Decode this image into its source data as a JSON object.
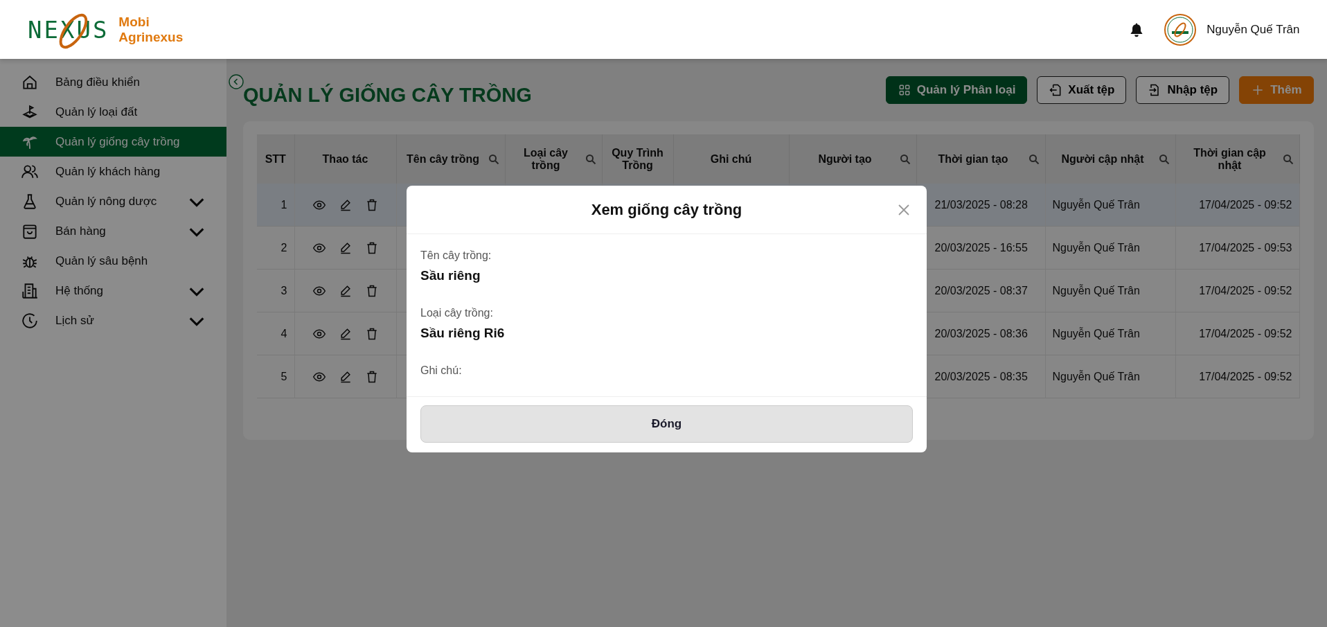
{
  "logo": {
    "mark": "NEXUS",
    "line1": "Mobi",
    "line2": "Agrinexus"
  },
  "user": {
    "name": "Nguyễn Quế Trân"
  },
  "sidebar": {
    "items": [
      {
        "label": "Bảng điều khiển",
        "selected": false,
        "has_submenu": false
      },
      {
        "label": "Quản lý loại đất",
        "selected": false,
        "has_submenu": false
      },
      {
        "label": "Quản lý giống cây trồng",
        "selected": true,
        "has_submenu": false
      },
      {
        "label": "Quản lý khách hàng",
        "selected": false,
        "has_submenu": false
      },
      {
        "label": "Quản lý nông dược",
        "selected": false,
        "has_submenu": true
      },
      {
        "label": "Bán hàng",
        "selected": false,
        "has_submenu": true
      },
      {
        "label": "Quản lý sâu bệnh",
        "selected": false,
        "has_submenu": false
      },
      {
        "label": "Hệ thống",
        "selected": false,
        "has_submenu": true
      },
      {
        "label": "Lịch sử",
        "selected": false,
        "has_submenu": true
      }
    ]
  },
  "page": {
    "title": "QUẢN LÝ GIỐNG CÂY TRỒNG"
  },
  "toolbar": [
    {
      "label": "Quản lý Phân loại",
      "kind": "categories"
    },
    {
      "label": "Xuất tệp",
      "kind": "export"
    },
    {
      "label": "Nhập tệp",
      "kind": "import"
    },
    {
      "label": "Thêm",
      "kind": "add"
    }
  ],
  "table": {
    "columns": [
      {
        "label": "STT",
        "searchable": false
      },
      {
        "label": "Thao tác",
        "searchable": false
      },
      {
        "label": "Tên cây trồng",
        "searchable": true
      },
      {
        "label": "Loại cây trồng",
        "searchable": true
      },
      {
        "label": "Quy Trình Trồng",
        "searchable": false
      },
      {
        "label": "Ghi chú",
        "searchable": false
      },
      {
        "label": "Người tạo",
        "searchable": true
      },
      {
        "label": "Thời gian tạo",
        "searchable": true
      },
      {
        "label": "Người cập nhật",
        "searchable": true
      },
      {
        "label": "Thời gian cập nhật",
        "searchable": true
      }
    ],
    "rows": [
      {
        "stt": "1",
        "created_at": "21/03/2025 - 08:28",
        "updated_by": "Nguyễn Quế Trân",
        "updated_at": "17/04/2025 - 09:52",
        "selected": true
      },
      {
        "stt": "2",
        "created_at": "20/03/2025 - 16:55",
        "updated_by": "Nguyễn Quế Trân",
        "updated_at": "17/04/2025 - 09:53",
        "selected": false
      },
      {
        "stt": "3",
        "created_at": "20/03/2025 - 08:37",
        "updated_by": "Nguyễn Quế Trân",
        "updated_at": "17/04/2025 - 09:52",
        "selected": false
      },
      {
        "stt": "4",
        "created_at": "20/03/2025 - 08:36",
        "updated_by": "Nguyễn Quế Trân",
        "updated_at": "17/04/2025 - 09:52",
        "selected": false
      },
      {
        "stt": "5",
        "created_at": "20/03/2025 - 08:35",
        "updated_by": "Nguyễn Quế Trân",
        "updated_at": "17/04/2025 - 09:52",
        "selected": false
      }
    ]
  },
  "dialog": {
    "title": "Xem giống cây trồng",
    "fields": [
      {
        "label": "Tên cây trồng:",
        "value": "Sầu riêng"
      },
      {
        "label": "Loại cây trồng:",
        "value": "Sầu riêng Ri6"
      },
      {
        "label": "Ghi chú:"
      }
    ],
    "button": "Đóng"
  }
}
